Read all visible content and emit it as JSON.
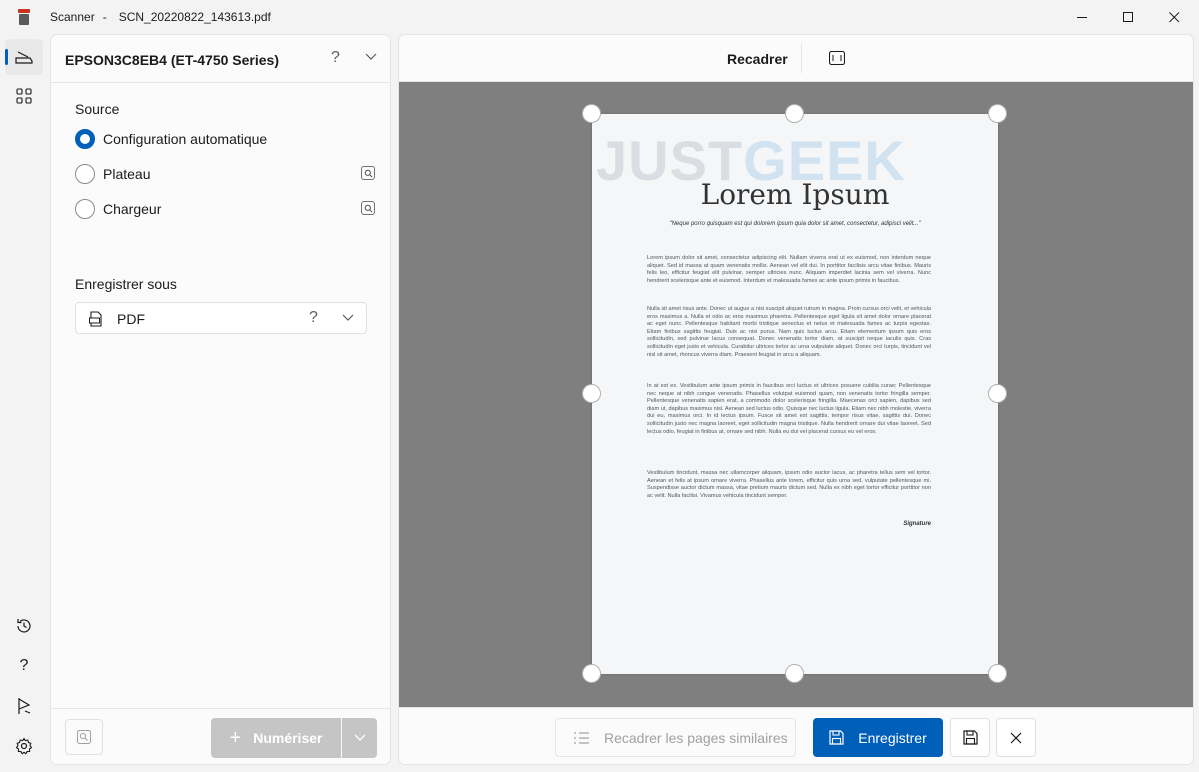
{
  "window": {
    "app_name": "Scanner",
    "separator": "-",
    "file_name": "SCN_20220822_143613.pdf",
    "controls": [
      "minimize-icon",
      "maximize-icon",
      "close-icon"
    ]
  },
  "rail": {
    "top_items": [
      {
        "icon": "scanner-icon",
        "active": true
      },
      {
        "icon": "apps-grid-icon",
        "active": false
      }
    ],
    "bottom_items": [
      {
        "icon": "history-icon"
      },
      {
        "icon": "help-icon"
      },
      {
        "icon": "feedback-icon"
      },
      {
        "icon": "settings-icon"
      }
    ]
  },
  "settings": {
    "device": "EPSON3C8EB4 (ET-4750 Series)",
    "help_glyph": "?",
    "source_label": "Source",
    "sources": [
      {
        "label": "Configuration automatique",
        "checked": true
      },
      {
        "label": "Plateau",
        "checked": false
      },
      {
        "label": "Chargeur",
        "checked": false
      }
    ],
    "save_as_label": "Enregistrer sous",
    "format": "PDF",
    "format_help": "?",
    "scan_button": "Numériser",
    "scan_plus": "+"
  },
  "preview": {
    "crop_label": "Recadrer",
    "document": {
      "watermark_a": "JUST",
      "watermark_b": "GEEK",
      "title": "Lorem Ipsum",
      "subtitle": "\"Neque porro quisquam est qui dolorem ipsum quia dolor sit amet, consectetur, adipisci velit...\"",
      "paragraphs": [
        "Lorem ipsum dolor sit amet, consectetur adipiscing elit. Nullam viverra erat ut ex euismod, non interdum neque aliquet. Sed id massa at quam venenatis mollis. Aenean vel elit dui. In porttitor facilisis arcu vitae finibus. Mauris felis leo, efficitur feugiat elit pulvinar, semper ultricies nunc. Aliquam imperdiet lacinia sem vel viverra. Nunc hendrerit scelerisque ante et euismod. Interdum et malesuada fames ac ante ipsum primis in faucibus.",
        "Nulla sit amet risus ante. Donec ut augue a nisi suscipit aliquet rutrum in magna. Proin cursus orci velit, et vehicula eros maximus a. Nulla et odio ac eros maximus pharetra. Pellentesque eget ligula sit amet dolor ornare placerat ac eget nunc. Pellentesque habitant morbi tristique senectus et netus et malesuada fames ac turpis egestas. Etiam finibus sagittis feugiat. Duis ac nisi purus. Nam quis luctus arcu. Etiam elementum ipsum quis eros sollicitudin, sed pulvinar lacus consequat. Donec venenatis tortor diam, at suscipit neque iaculis quis. Cras sollicitudin eget justo et vehicula. Curabitur ultrices tortor ac urna vulputate aliquet. Donec orci turpis, tincidunt vel nisl sit amet, rhoncus viverra diam. Praesent feugiat in arcu a aliquam.",
        "In at est ex. Vestibulum ante ipsum primis in faucibus orci luctus et ultrices posuere cubilia curae; Pellentesque nec neque at nibh congue venenatis. Phasellus volutpat euismod quam, non venenatis tortor fringilla semper. Pellentesque venenatis sapien erat, a commodo dolor scelerisque fringilla. Maecenas orci sapien, dapibus sed diam ut, dapibus maximus nisl. Aenean sed luctus odio. Quisque nec luctus ligula. Etiam nec nibh molestie, viverra dui eu, maximus orci. In id lectus ipsum. Fusce sit amet est sagittis, tempor risus vitae, sagittis dui. Donec sollicitudin justo nec magna laoreet, eget sollicitudin magna tristique. Nulla hendrerit ornare dui vitae laoreet. Sed lectus odio, feugiat in finibus at, ornare sed nibh. Nulla eu dui vel placerat cursus eu vel eros.",
        "Vestibulum tincidunt, massa nec ullamcorper aliquam, ipsum odio auctor lacus, ac pharetra tellus sem vel tortor. Aenean et felis at ipsum ornare viverra. Phasellus ante lorem, efficitur quis urna sed, vulputate pellentesque mi. Suspendisse auctor dictum massa, vitae pretium mauris dictum sed. Nulla ex nibh eget tortor efficitur porttitor non ac velit. Nulla facilisi. Vivamus vehicula tincidunt semper."
      ],
      "signature": "Signature"
    },
    "crop_similar": "Recadrer les pages similaires",
    "save_button": "Enregistrer"
  },
  "colors": {
    "accent": "#005fb8",
    "canvas": "#7f7f7f",
    "disabled": "#c5c5c5"
  }
}
